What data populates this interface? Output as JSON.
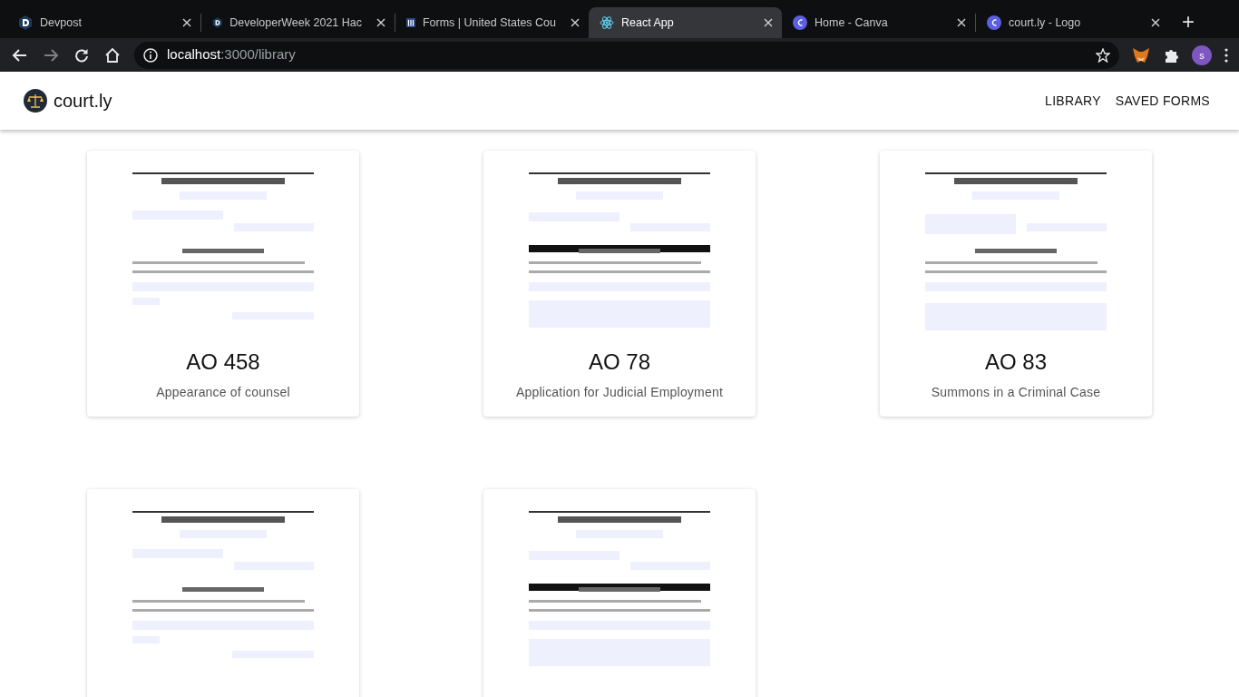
{
  "browser": {
    "tabs": [
      {
        "title": "Devpost",
        "kind": "devpost",
        "selected": false
      },
      {
        "title": "DeveloperWeek 2021 Hac",
        "kind": "devpost",
        "selected": false
      },
      {
        "title": "Forms | United States Cou",
        "kind": "courts",
        "selected": false
      },
      {
        "title": "React App",
        "kind": "react",
        "selected": true
      },
      {
        "title": "Home - Canva",
        "kind": "canva",
        "selected": false
      },
      {
        "title": "court.ly - Logo",
        "kind": "canva",
        "selected": false
      }
    ],
    "new_tab": "+",
    "address": {
      "host": "localhost",
      "path": ":3000/library"
    },
    "profile_initial": "s"
  },
  "app": {
    "logo": "court.ly",
    "nav": [
      {
        "label": "LIBRARY"
      },
      {
        "label": "SAVED FORMS"
      }
    ]
  },
  "forms": [
    {
      "code": "AO 458",
      "name": "Appearance of counsel"
    },
    {
      "code": "AO 78",
      "name": "Application for Judicial Employment"
    },
    {
      "code": "AO 83",
      "name": "Summons in a Criminal Case"
    },
    {
      "kind": "picture"
    },
    {
      "kind": "picture"
    }
  ]
}
